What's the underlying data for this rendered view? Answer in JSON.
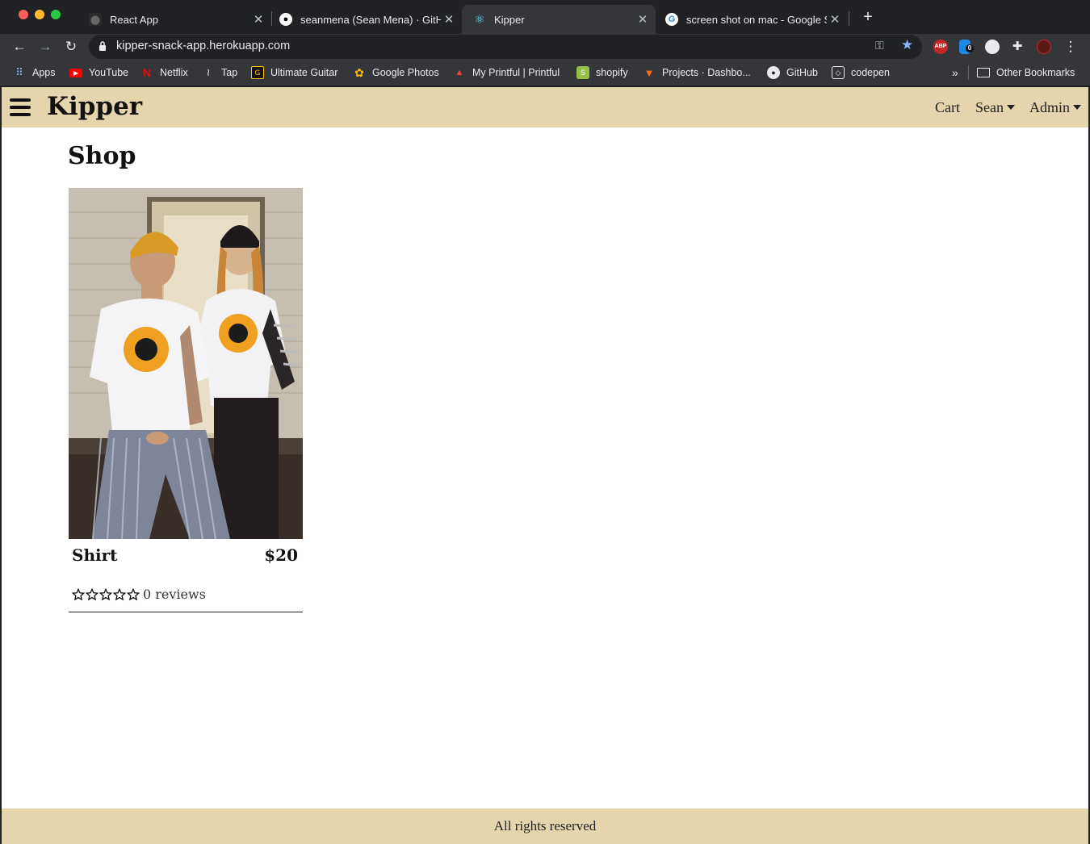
{
  "browser": {
    "tabs": [
      {
        "title": "React App",
        "icon": "github-dark-icon"
      },
      {
        "title": "seanmena (Sean Mena) · GitHub",
        "icon": "github-icon"
      },
      {
        "title": "Kipper",
        "icon": "react-icon"
      },
      {
        "title": "screen shot on mac - Google Search",
        "icon": "google-icon"
      }
    ],
    "url": "kipper-snack-app.herokuapp.com",
    "bookmarks": [
      {
        "label": "Apps",
        "icon": "apps-grid-icon"
      },
      {
        "label": "YouTube",
        "icon": "youtube-icon"
      },
      {
        "label": "Netflix",
        "icon": "netflix-icon"
      },
      {
        "label": "Tap",
        "icon": "tap-icon"
      },
      {
        "label": "Ultimate Guitar",
        "icon": "ultimate-guitar-icon"
      },
      {
        "label": "Google Photos",
        "icon": "google-photos-icon"
      },
      {
        "label": "My Printful | Printful",
        "icon": "printful-icon"
      },
      {
        "label": "shopify",
        "icon": "shopify-icon"
      },
      {
        "label": "Projects · Dashbo...",
        "icon": "gitlab-icon"
      },
      {
        "label": "GitHub",
        "icon": "github-icon"
      },
      {
        "label": "codepen",
        "icon": "codepen-icon"
      }
    ],
    "overflow": "»",
    "other_bookmarks": "Other Bookmarks",
    "extensions": {
      "abp": "ABP",
      "badge": "0"
    }
  },
  "site": {
    "brand": "Kipper",
    "nav": {
      "cart": "Cart",
      "user": "Sean",
      "admin": "Admin"
    },
    "page_title": "Shop",
    "products": [
      {
        "name": "Shirt",
        "price": "$20",
        "rating": 0,
        "reviews": "0 reviews"
      }
    ],
    "footer": "All rights reserved",
    "colors": {
      "navbar": "#e5d5ad",
      "text": "#111111"
    }
  }
}
